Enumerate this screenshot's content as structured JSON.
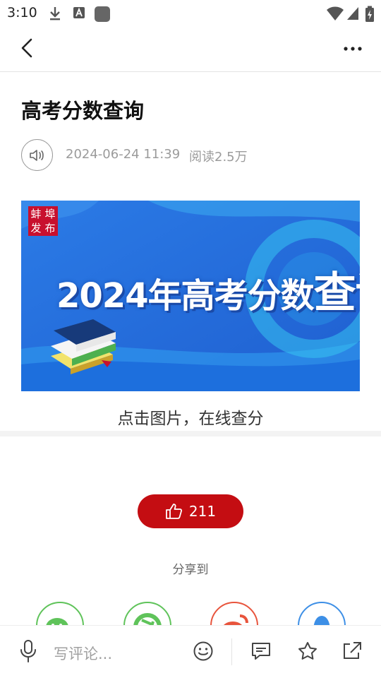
{
  "status_bar": {
    "time": "3:10"
  },
  "article": {
    "title": "高考分数查询",
    "date": "2024-06-24 11:39",
    "reads": "阅读2.5万",
    "banner": {
      "headline_prefix": "2024年高考分数",
      "headline_suffix": "查询",
      "seal_text": [
        "埠",
        "蚌",
        "布",
        "发"
      ]
    },
    "caption": "点击图片，在线查分"
  },
  "like": {
    "count": "211"
  },
  "share": {
    "label": "分享到",
    "targets": [
      "wechat-icon",
      "moments-icon",
      "weibo-icon",
      "qq-icon"
    ]
  },
  "bottom_bar": {
    "comment_placeholder": "写评论..."
  },
  "colors": {
    "accent": "#c40d12",
    "banner_blue": "#2d7fe0",
    "wechat": "#5fc35a",
    "moments": "#5fc35a",
    "weibo": "#e8543c",
    "qq": "#3d8fe6"
  }
}
